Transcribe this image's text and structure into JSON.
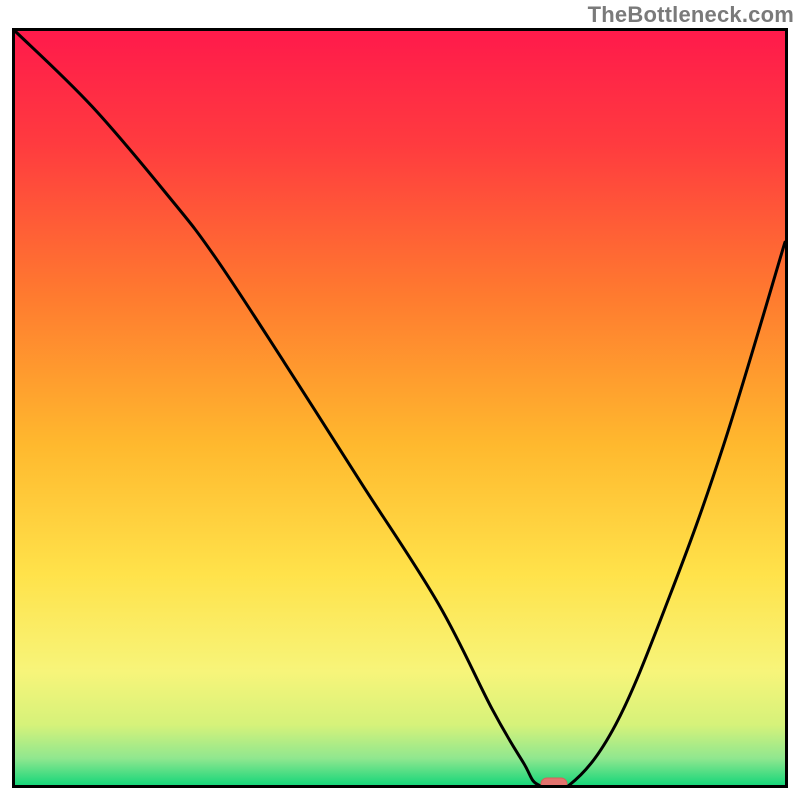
{
  "watermark": "TheBottleneck.com",
  "chart_data": {
    "type": "line",
    "title": "",
    "xlabel": "",
    "ylabel": "",
    "xlim": [
      0,
      100
    ],
    "ylim": [
      0,
      100
    ],
    "x": [
      0,
      10,
      20,
      26,
      35,
      45,
      55,
      62,
      66,
      68,
      72,
      78,
      85,
      92,
      100
    ],
    "values": [
      100,
      90,
      78,
      70,
      56,
      40,
      24,
      10,
      3,
      0,
      0,
      8,
      25,
      45,
      72
    ],
    "marker": {
      "x": 70,
      "y": 0
    },
    "gradient_stops": [
      {
        "offset": 0.0,
        "color": "#ff1a4b"
      },
      {
        "offset": 0.15,
        "color": "#ff3b3f"
      },
      {
        "offset": 0.35,
        "color": "#ff7a2f"
      },
      {
        "offset": 0.55,
        "color": "#ffb92e"
      },
      {
        "offset": 0.72,
        "color": "#ffe24a"
      },
      {
        "offset": 0.85,
        "color": "#f7f57a"
      },
      {
        "offset": 0.92,
        "color": "#d6f27a"
      },
      {
        "offset": 0.965,
        "color": "#8fe78f"
      },
      {
        "offset": 1.0,
        "color": "#17d67a"
      }
    ],
    "colors": {
      "curve": "#000000",
      "frame": "#000000",
      "marker_fill": "#e2736e",
      "marker_stroke": "#d85f59"
    }
  }
}
